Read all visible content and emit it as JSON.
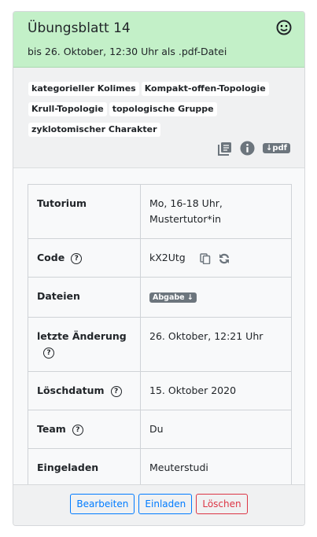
{
  "header": {
    "title": "Übungsblatt 14",
    "subtitle": "bis 26. Oktober, 12:30 Uhr als .pdf-Datei"
  },
  "tags": [
    "kategorieller Kolimes",
    "Kompakt-offen-Topologie",
    "Krull-Topologie",
    "topologische Gruppe",
    "zyklotomischer Charakter"
  ],
  "actions": {
    "pdf_label": "↓pdf"
  },
  "table": {
    "tutorium_label": "Tutorium",
    "tutorium_value": "Mo, 16-18 Uhr, Mustertutor*in",
    "code_label": "Code",
    "code_value": "kX2Utg",
    "dateien_label": "Dateien",
    "abgabe_label": "Abgabe ↓",
    "aenderung_label": "letzte Änderung",
    "aenderung_value": "26. Oktober, 12:21 Uhr",
    "loeschdatum_label": "Löschdatum",
    "loeschdatum_value": "15. Oktober 2020",
    "team_label": "Team",
    "team_value": "Du",
    "eingeladen_label": "Eingeladen",
    "eingeladen_value": "Meuterstudi"
  },
  "help_glyph": "?",
  "footer": {
    "edit": "Bearbeiten",
    "invite": "Einladen",
    "delete": "Löschen"
  }
}
